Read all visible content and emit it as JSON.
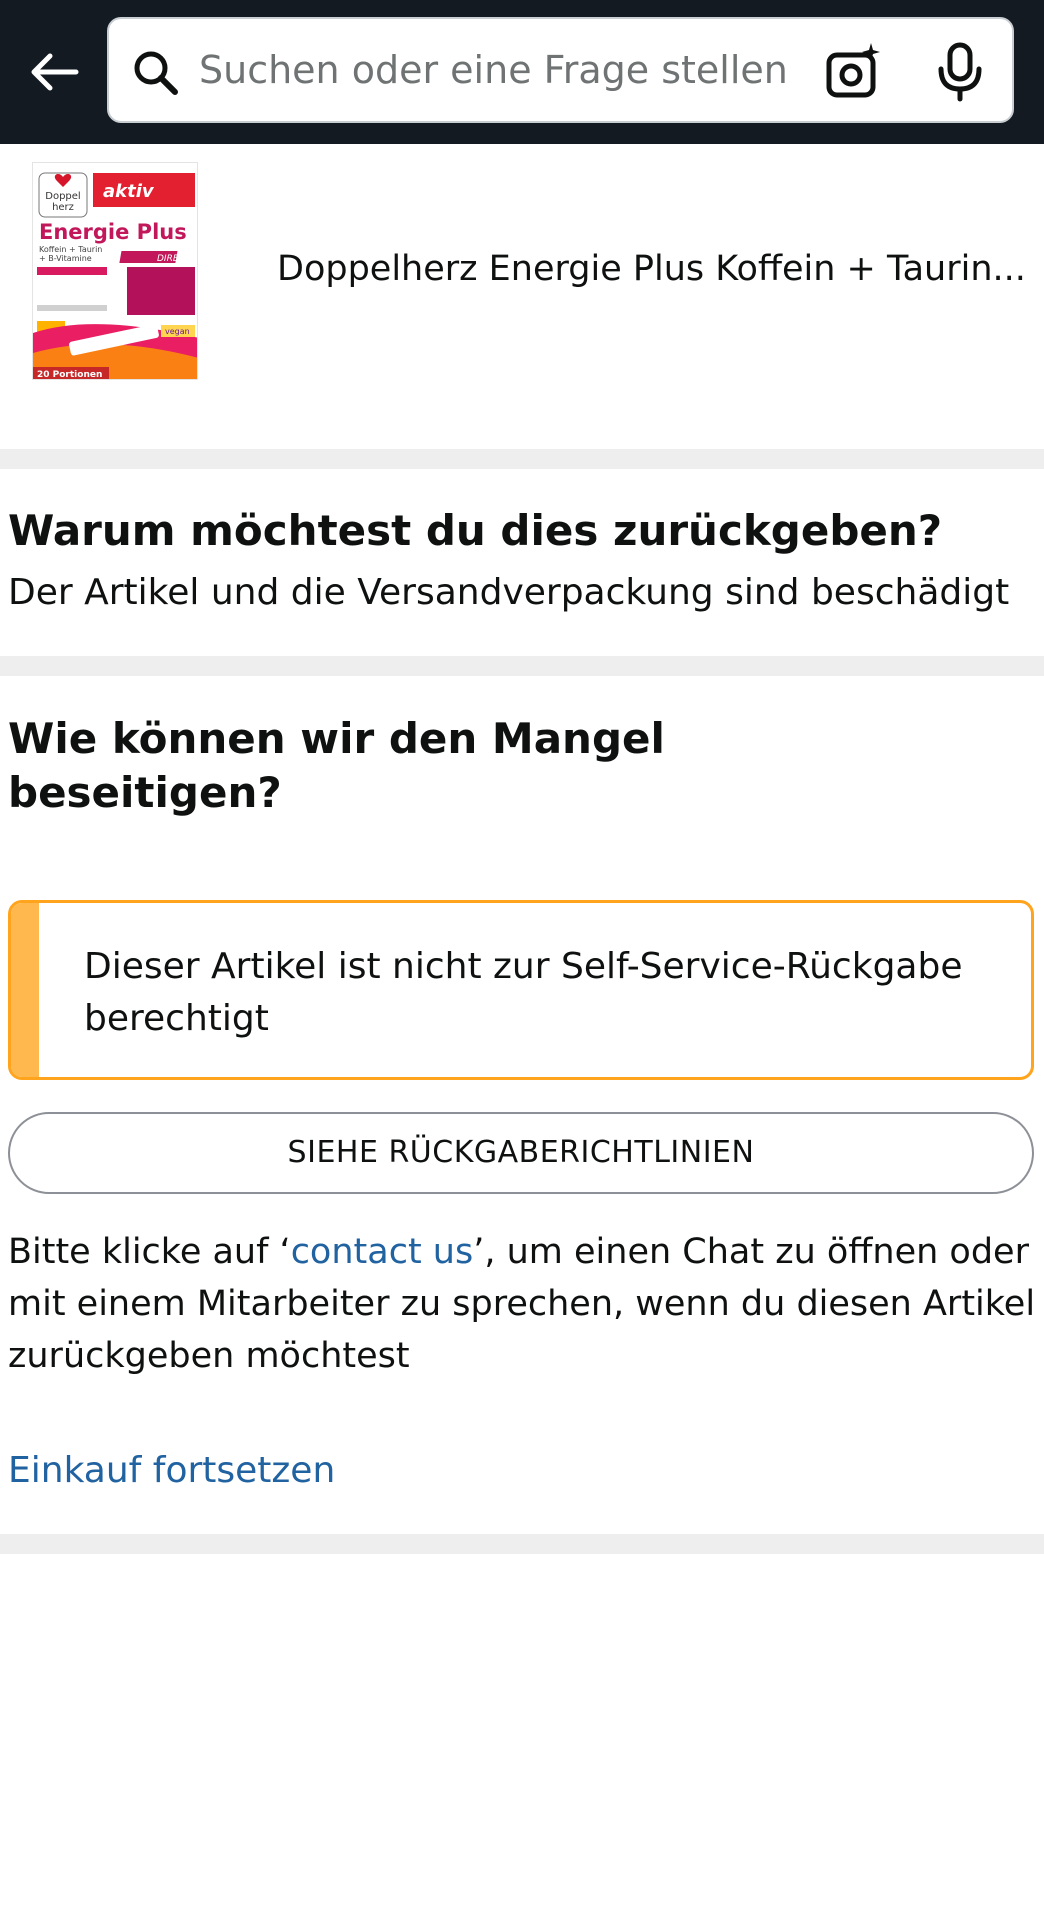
{
  "header": {
    "search_placeholder": "Suchen oder eine Frage stellen",
    "back_icon": "back-arrow-icon",
    "camera_icon": "camera-sparkle-icon",
    "mic_icon": "microphone-icon",
    "background_color": "#131a22"
  },
  "product": {
    "title": "Doppelherz Energie Plus Koffein + Taurin...",
    "image": {
      "brand_top": "Doppel",
      "brand_bottom": "herz",
      "line": "aktiv",
      "name": "Energie Plus",
      "subtitle": "Koffein + Taurin",
      "subtitle2": "+ B-Vitamine",
      "badge": "DIRECT",
      "vegan": "vegan",
      "portions": "20 Portionen"
    }
  },
  "return_reason": {
    "heading": "Warum möchtest du dies zurückgeben?",
    "reason": "Der Artikel und die Versandverpackung sind beschädigt"
  },
  "resolution": {
    "heading_line1": "Wie können wir den Mangel",
    "heading_line2": "beseitigen?",
    "alert_text": "Dieser Artikel ist nicht zur Self-Service-Rückgabe berechtigt",
    "alert_color": "#ffa41c",
    "policy_button_label": "SIEHE RÜCKGABERICHTLINIEN",
    "info_prefix": "Bitte klicke auf ‘",
    "info_link": "contact us",
    "info_suffix": "’, um einen Chat zu öffnen oder mit einem Mitarbeiter zu sprechen, wenn du diesen Artikel zurückgeben möchtest",
    "link_color": "#2162a1",
    "continue_link": "Einkauf fortsetzen"
  }
}
